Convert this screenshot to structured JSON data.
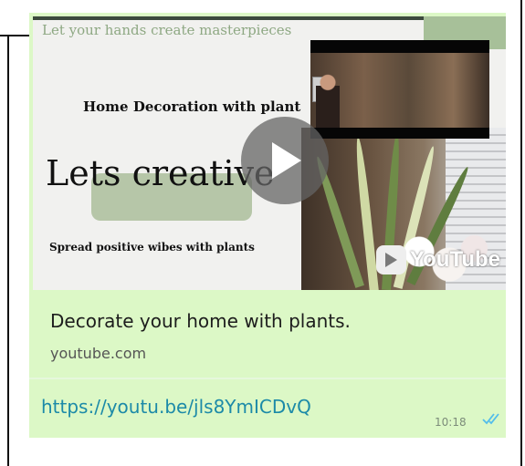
{
  "message": {
    "preview": {
      "thumbnail": {
        "tagline": "Let your hands create masterpieces",
        "heading": "Home Decoration with plant",
        "big_text": "Lets creative",
        "subtext": "Spread positive wibes with plants",
        "watermark": "YouTube",
        "play_icon": "play-icon"
      },
      "title": "Decorate your home with plants.",
      "domain": "youtube.com"
    },
    "link_text": "https://youtu.be/jls8YmICDvQ",
    "time": "10:18",
    "status_icon": "double-check-icon",
    "colors": {
      "bubble": "#dcf8c6",
      "link": "#1c8aa8",
      "read_ticks": "#53bdeb"
    }
  }
}
